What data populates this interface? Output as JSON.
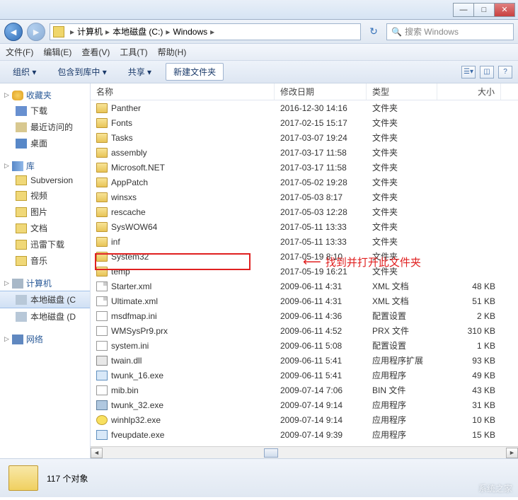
{
  "window": {
    "min": "—",
    "max": "□",
    "close": "✕"
  },
  "breadcrumb": {
    "seg1": "计算机",
    "seg2": "本地磁盘 (C:)",
    "seg3": "Windows",
    "sep": "▸"
  },
  "search": {
    "placeholder": "搜索 Windows"
  },
  "menu": {
    "file": "文件(F)",
    "edit": "编辑(E)",
    "view": "查看(V)",
    "tools": "工具(T)",
    "help": "帮助(H)"
  },
  "toolbar": {
    "org": "组织 ▾",
    "inc": "包含到库中 ▾",
    "share": "共享 ▾",
    "new": "新建文件夹"
  },
  "sidebar": {
    "fav": "收藏夹",
    "dl": "下载",
    "recent": "最近访问的",
    "desk": "桌面",
    "lib": "库",
    "svn": "Subversion",
    "vid": "视频",
    "pic": "图片",
    "doc": "文档",
    "xldl": "迅雷下载",
    "music": "音乐",
    "pc": "计算机",
    "diskC": "本地磁盘 (C",
    "diskD": "本地磁盘 (D",
    "net": "网络"
  },
  "columns": {
    "name": "名称",
    "date": "修改日期",
    "type": "类型",
    "size": "大小"
  },
  "files": [
    {
      "icon": "folder",
      "name": "Panther",
      "date": "2016-12-30 14:16",
      "type": "文件夹",
      "size": ""
    },
    {
      "icon": "folder",
      "name": "Fonts",
      "date": "2017-02-15 15:17",
      "type": "文件夹",
      "size": ""
    },
    {
      "icon": "folder",
      "name": "Tasks",
      "date": "2017-03-07 19:24",
      "type": "文件夹",
      "size": ""
    },
    {
      "icon": "folder",
      "name": "assembly",
      "date": "2017-03-17 11:58",
      "type": "文件夹",
      "size": ""
    },
    {
      "icon": "folder",
      "name": "Microsoft.NET",
      "date": "2017-03-17 11:58",
      "type": "文件夹",
      "size": ""
    },
    {
      "icon": "folder",
      "name": "AppPatch",
      "date": "2017-05-02 19:28",
      "type": "文件夹",
      "size": ""
    },
    {
      "icon": "folder",
      "name": "winsxs",
      "date": "2017-05-03 8:17",
      "type": "文件夹",
      "size": ""
    },
    {
      "icon": "folder",
      "name": "rescache",
      "date": "2017-05-03 12:28",
      "type": "文件夹",
      "size": ""
    },
    {
      "icon": "folder",
      "name": "SysWOW64",
      "date": "2017-05-11 13:33",
      "type": "文件夹",
      "size": ""
    },
    {
      "icon": "folder",
      "name": "inf",
      "date": "2017-05-11 13:33",
      "type": "文件夹",
      "size": ""
    },
    {
      "icon": "folder",
      "name": "System32",
      "date": "2017-05-19 8:10",
      "type": "文件夹",
      "size": ""
    },
    {
      "icon": "folder",
      "name": "temp",
      "date": "2017-05-19 16:21",
      "type": "文件夹",
      "size": ""
    },
    {
      "icon": "xml",
      "name": "Starter.xml",
      "date": "2009-06-11 4:31",
      "type": "XML 文档",
      "size": "48 KB"
    },
    {
      "icon": "xml",
      "name": "Ultimate.xml",
      "date": "2009-06-11 4:31",
      "type": "XML 文档",
      "size": "51 KB"
    },
    {
      "icon": "ini",
      "name": "msdfmap.ini",
      "date": "2009-06-11 4:36",
      "type": "配置设置",
      "size": "2 KB"
    },
    {
      "icon": "prx",
      "name": "WMSysPr9.prx",
      "date": "2009-06-11 4:52",
      "type": "PRX 文件",
      "size": "310 KB"
    },
    {
      "icon": "ini",
      "name": "system.ini",
      "date": "2009-06-11 5:08",
      "type": "配置设置",
      "size": "1 KB"
    },
    {
      "icon": "dll",
      "name": "twain.dll",
      "date": "2009-06-11 5:41",
      "type": "应用程序扩展",
      "size": "93 KB"
    },
    {
      "icon": "exe",
      "name": "twunk_16.exe",
      "date": "2009-06-11 5:41",
      "type": "应用程序",
      "size": "49 KB"
    },
    {
      "icon": "bin",
      "name": "mib.bin",
      "date": "2009-07-14 7:06",
      "type": "BIN 文件",
      "size": "43 KB"
    },
    {
      "icon": "exe2",
      "name": "twunk_32.exe",
      "date": "2009-07-14 9:14",
      "type": "应用程序",
      "size": "31 KB"
    },
    {
      "icon": "help",
      "name": "winhlp32.exe",
      "date": "2009-07-14 9:14",
      "type": "应用程序",
      "size": "10 KB"
    },
    {
      "icon": "exe",
      "name": "fveupdate.exe",
      "date": "2009-07-14 9:39",
      "type": "应用程序",
      "size": "15 KB"
    }
  ],
  "annotation": "找到并打开此文件夹",
  "status": {
    "count": "117 个对象"
  },
  "watermark": "系统之家"
}
